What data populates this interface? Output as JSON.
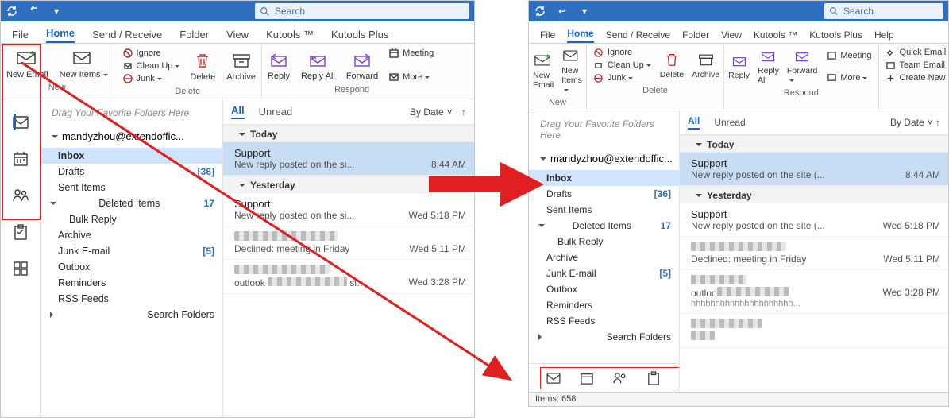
{
  "search_placeholder": "Search",
  "tabs": {
    "file": "File",
    "home": "Home",
    "sendreceive": "Send / Receive",
    "folder": "Folder",
    "view": "View",
    "kutools": "Kutools ™",
    "kutoolsplus": "Kutools Plus",
    "help": "Help"
  },
  "ribbon": {
    "new_email": "New Email",
    "new_items": "New Items",
    "ignore": "Ignore",
    "cleanup": "Clean Up",
    "junk": "Junk",
    "delete": "Delete",
    "archive": "Archive",
    "reply": "Reply",
    "replyall": "Reply All",
    "forward": "Forward",
    "meeting": "Meeting",
    "more": "More",
    "quick": "Quick Email",
    "team": "Team Email",
    "create": "Create New",
    "grp_new": "New",
    "grp_delete": "Delete",
    "grp_respond": "Respond"
  },
  "fav_drop": "Drag Your Favorite Folders Here",
  "account": "mandyzhou@extendoffic...",
  "folders": [
    {
      "name": "Inbox",
      "sel": true
    },
    {
      "name": "Drafts",
      "count": "[36]"
    },
    {
      "name": "Sent Items"
    },
    {
      "name": "Deleted Items",
      "count": "17",
      "open": true
    },
    {
      "name": "Bulk Reply",
      "sub": true
    },
    {
      "name": "Archive"
    },
    {
      "name": "Junk E-mail",
      "count": "[5]"
    },
    {
      "name": "Outbox"
    },
    {
      "name": "Reminders"
    },
    {
      "name": "RSS Feeds"
    },
    {
      "name": "Search Folders",
      "arrow": true
    }
  ],
  "list": {
    "all": "All",
    "unread": "Unread",
    "sortby": "By Date",
    "groups": [
      {
        "hd": "Today",
        "msgs": [
          {
            "from": "Support",
            "subj": "New reply posted on the si...",
            "time": "8:44 AM",
            "sel": true
          }
        ]
      },
      {
        "hd": "Yesterday",
        "msgs": [
          {
            "from": "Support",
            "subj": "New reply posted on the si...",
            "time": "Wed 5:18 PM"
          },
          {
            "from_blur": 130,
            "subj": "Declined: meeting in Friday",
            "time": "Wed 5:11 PM"
          },
          {
            "from_blur": 120,
            "subj_prefix": "outlook ",
            "subj_blur": 100,
            "subj_suffix": " signature",
            "time": "Wed 3:28 PM"
          }
        ]
      }
    ]
  },
  "right_list": {
    "groups": [
      {
        "hd": "Today",
        "msgs": [
          {
            "from": "Support",
            "subj": "New reply posted on the site (...",
            "time": "8:44 AM",
            "sel": true
          }
        ]
      },
      {
        "hd": "Yesterday",
        "msgs": [
          {
            "from": "Support",
            "subj": "New reply posted on the site (...",
            "time": "Wed 5:18 PM"
          },
          {
            "from_blur": 120,
            "subj": "Declined: meeting in Friday",
            "time": "Wed 5:11 PM"
          },
          {
            "from_blur": 70,
            "subj_prefix": "outloo",
            "subj_blur": 90,
            "time": "Wed 3:28 PM",
            "extra": "hhhhhhhhhhhhhhhhhhhhh..."
          },
          {
            "from_blur": 90,
            "subj_blur": 30,
            "time": ""
          }
        ]
      }
    ]
  },
  "status": "Items: 658"
}
